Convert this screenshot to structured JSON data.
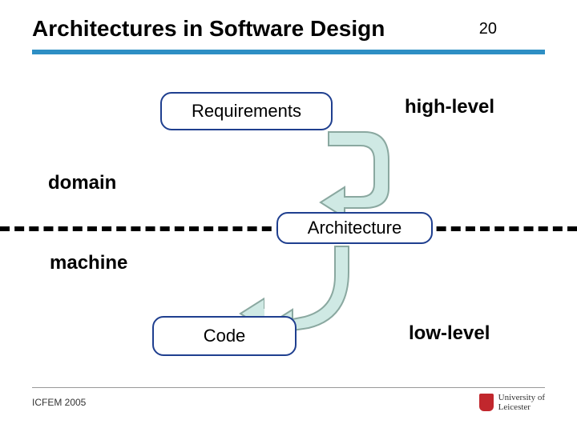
{
  "title": "Architectures in Software Design",
  "page_number": "20",
  "boxes": {
    "requirements": "Requirements",
    "architecture": "Architecture",
    "code": "Code"
  },
  "labels": {
    "high_level": "high-level",
    "low_level": "low-level",
    "domain": "domain",
    "machine": "machine"
  },
  "footer": {
    "left": "ICFEM 2005",
    "affiliation_line1": "University of",
    "affiliation_line2": "Leicester"
  },
  "colors": {
    "title_rule": "#2e8fc4",
    "box_border": "#1f3f8f",
    "arrow_fill": "#cfe9e4",
    "arrow_stroke": "#8aa8a0"
  }
}
